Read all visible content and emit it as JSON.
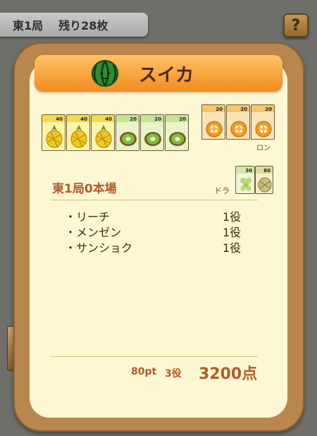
{
  "header": {
    "round": "東1局",
    "remaining": "残り28枚",
    "help_label": "?"
  },
  "result": {
    "title": "スイカ",
    "ron_label": "ロン",
    "dora_label": "ドラ",
    "hand_name": "東1局0本場",
    "hand_tiles": [
      {
        "fruit": "pineapple",
        "value": "40"
      },
      {
        "fruit": "pineapple",
        "value": "40"
      },
      {
        "fruit": "pineapple",
        "value": "40"
      },
      {
        "fruit": "kiwi",
        "value": "20"
      },
      {
        "fruit": "kiwi",
        "value": "20"
      },
      {
        "fruit": "kiwi",
        "value": "20"
      }
    ],
    "meld_tiles": [
      {
        "fruit": "orange",
        "value": "20"
      },
      {
        "fruit": "orange",
        "value": "20"
      },
      {
        "fruit": "orange",
        "value": "20"
      }
    ],
    "dora_tiles": [
      {
        "fruit": "grape",
        "value": "30"
      },
      {
        "fruit": "durian",
        "value": "60"
      }
    ],
    "yaku": [
      {
        "name": "・リーチ",
        "han": "1役"
      },
      {
        "name": "・メンゼン",
        "han": "1役"
      },
      {
        "name": "・サンショク",
        "han": "1役"
      }
    ],
    "points": "80pt",
    "han_total": "3役",
    "score": "3200点"
  }
}
